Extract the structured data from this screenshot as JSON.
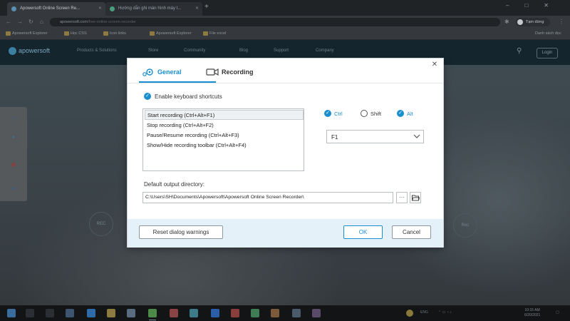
{
  "browser": {
    "tabs": [
      {
        "title": "Apowersoft Online Screen Re..."
      },
      {
        "title": "Hướng dẫn ghi màn hình máy t..."
      }
    ],
    "new_tab_label": "+",
    "window_controls": [
      "–",
      "□",
      "✕"
    ],
    "address": "apowersoft.com",
    "address_rest": "/free-online-screen-recorder",
    "profile_label": "Tạm dừng",
    "bookmarks": [
      "Apowersoft Explorer",
      "Học CSS",
      "Icon links",
      "Apowersoft Explorer",
      "File excel"
    ],
    "reading_list_label": "Danh sách đọc"
  },
  "site": {
    "logo_text": "apowersoft",
    "nav_items": [
      "Products & Solutions",
      "Store",
      "Community",
      "Blog",
      "Support",
      "Company"
    ],
    "login_label": "Login",
    "share_items": [
      "Share",
      "Share",
      "Pin",
      "Share"
    ],
    "left_control_label": "REC",
    "right_control_label": "Rec"
  },
  "dialog": {
    "tabs": {
      "general": "General",
      "recording": "Recording"
    },
    "enable_shortcuts": {
      "label": "Enable keyboard shortcuts",
      "checked": true
    },
    "shortcuts": [
      {
        "label": "Start recording (Ctrl+Alt+F1)",
        "selected": true
      },
      {
        "label": "Stop recording (Ctrl+Alt+F2)",
        "selected": false
      },
      {
        "label": "Pause/Resume recording (Ctrl+Alt+F3)",
        "selected": false
      },
      {
        "label": "Show/Hide recording toolbar (Ctrl+Alt+F4)",
        "selected": false
      }
    ],
    "modifiers": {
      "ctrl": {
        "label": "Ctrl",
        "checked": true
      },
      "shift": {
        "label": "Shift",
        "checked": false
      },
      "alt": {
        "label": "Alt",
        "checked": true
      }
    },
    "key_value": "F1",
    "output_dir_label": "Default output directory:",
    "output_dir_value": "C:\\Users\\SH\\Documents\\Apowersoft\\Apowersoft Online Screen Recorder\\",
    "browse_more_label": "···",
    "buttons": {
      "reset": "Reset dialog warnings",
      "ok": "OK",
      "cancel": "Cancel"
    },
    "close_glyph": "✕",
    "accent_color": "#1a8fcf"
  },
  "taskbar": {
    "language": "ENG",
    "time": "10:15 AM",
    "date": "6/20/2021"
  }
}
